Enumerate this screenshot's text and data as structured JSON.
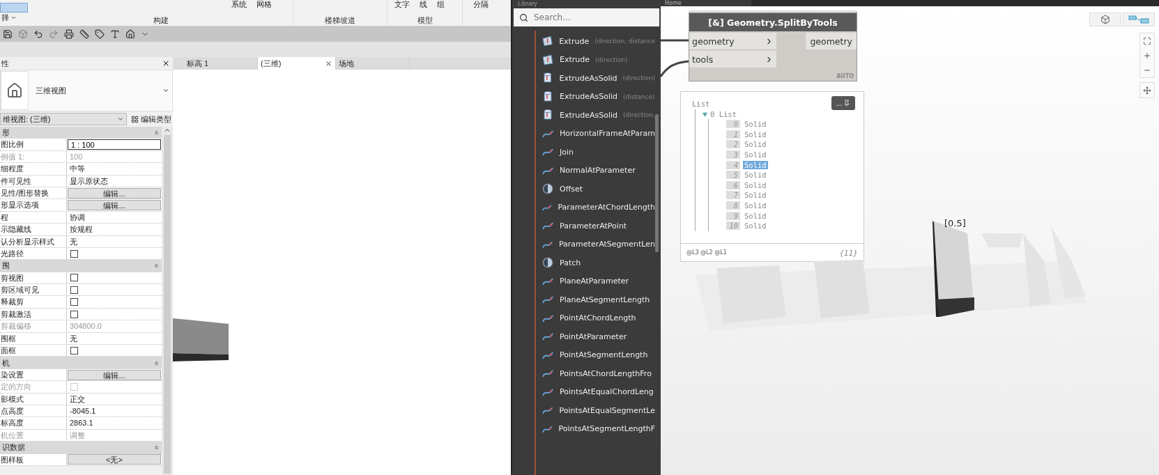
{
  "ribbon": {
    "select_label": "择",
    "panels": [
      {
        "label": "构建",
        "buttons": [
          "系统",
          "网格"
        ]
      },
      {
        "label": "楼梯坡道"
      },
      {
        "label": "模型",
        "buttons": [
          "文字",
          "线",
          "组"
        ]
      },
      {
        "buttons": [
          "分隔"
        ]
      }
    ]
  },
  "view_tabs": [
    {
      "label": "标高 1",
      "selected": false
    },
    {
      "label": "(三维)",
      "selected": true
    },
    {
      "label": "场地",
      "selected": false
    }
  ],
  "properties": {
    "title": "性",
    "type_name": "三维视图",
    "instance": "维视图: (三维)",
    "edit_type": "编辑类型",
    "sections": [
      {
        "title": "形",
        "rows": [
          {
            "label": "图比例",
            "kind": "input",
            "value": "1 : 100"
          },
          {
            "label": "例值 1:",
            "kind": "text",
            "value": "100",
            "disabled": true
          },
          {
            "label": "细程度",
            "kind": "text",
            "value": "中等"
          },
          {
            "label": "件可见性",
            "kind": "text",
            "value": "显示原状态"
          },
          {
            "label": "见性/图形替换",
            "kind": "button",
            "value": "编辑..."
          },
          {
            "label": "形显示选项",
            "kind": "button",
            "value": "编辑..."
          },
          {
            "label": "程",
            "kind": "text",
            "value": "协调"
          },
          {
            "label": "示隐藏线",
            "kind": "text",
            "value": "按规程"
          },
          {
            "label": "认分析显示样式",
            "kind": "text",
            "value": "无"
          },
          {
            "label": "光路径",
            "kind": "checkbox",
            "checked": false
          }
        ]
      },
      {
        "title": "围",
        "rows": [
          {
            "label": "剪视图",
            "kind": "checkbox",
            "checked": false
          },
          {
            "label": "剪区域可见",
            "kind": "checkbox",
            "checked": false
          },
          {
            "label": "释裁剪",
            "kind": "checkbox",
            "checked": false
          },
          {
            "label": "剪裁激活",
            "kind": "checkbox",
            "checked": false
          },
          {
            "label": "剪裁偏移",
            "kind": "text",
            "value": "304800.0",
            "disabled": true
          },
          {
            "label": "围框",
            "kind": "text",
            "value": "无"
          },
          {
            "label": "面框",
            "kind": "checkbox",
            "checked": false
          }
        ]
      },
      {
        "title": "机",
        "rows": [
          {
            "label": "染设置",
            "kind": "button",
            "value": "编辑..."
          },
          {
            "label": "定的方向",
            "kind": "checkbox",
            "checked": false,
            "disabled": true
          },
          {
            "label": "影模式",
            "kind": "text",
            "value": "正交"
          },
          {
            "label": "点高度",
            "kind": "text",
            "value": "-8045.1"
          },
          {
            "label": "标高度",
            "kind": "text",
            "value": "2863.1"
          },
          {
            "label": "机位置",
            "kind": "text",
            "value": "调整",
            "disabled": true
          }
        ]
      },
      {
        "title": "识数据",
        "rows": [
          {
            "label": "图样板",
            "kind": "button",
            "value": "<无>"
          }
        ]
      }
    ]
  },
  "library": {
    "title": "Library",
    "search": {
      "placeholder": "Search..."
    },
    "items": [
      {
        "name": "Extrude",
        "hint": "(direction, distance",
        "kind": "surface"
      },
      {
        "name": "Extrude",
        "hint": "(direction)",
        "kind": "surface"
      },
      {
        "name": "ExtrudeAsSolid",
        "hint": "(direction)",
        "kind": "solid"
      },
      {
        "name": "ExtrudeAsSolid",
        "hint": "(distance)",
        "kind": "solid"
      },
      {
        "name": "ExtrudeAsSolid",
        "hint": "(direction,",
        "kind": "solid"
      },
      {
        "name": "HorizontalFrameAtParam",
        "kind": "curve"
      },
      {
        "name": "Join",
        "kind": "curve"
      },
      {
        "name": "NormalAtParameter",
        "kind": "curve"
      },
      {
        "name": "Offset",
        "kind": "disc"
      },
      {
        "name": "ParameterAtChordLength",
        "kind": "curve"
      },
      {
        "name": "ParameterAtPoint",
        "kind": "curve"
      },
      {
        "name": "ParameterAtSegmentLen",
        "kind": "curve"
      },
      {
        "name": "Patch",
        "kind": "disc"
      },
      {
        "name": "PlaneAtParameter",
        "kind": "curve"
      },
      {
        "name": "PlaneAtSegmentLength",
        "kind": "curve"
      },
      {
        "name": "PointAtChordLength",
        "kind": "curve"
      },
      {
        "name": "PointAtParameter",
        "kind": "curve"
      },
      {
        "name": "PointAtSegmentLength",
        "kind": "curve"
      },
      {
        "name": "PointsAtChordLengthFro",
        "kind": "curve"
      },
      {
        "name": "PointsAtEqualChordLeng",
        "kind": "curve"
      },
      {
        "name": "PointsAtEqualSegmentLe",
        "kind": "curve"
      },
      {
        "name": "PointsAtSegmentLengthF",
        "kind": "curve"
      }
    ]
  },
  "canvas": {
    "tab": "Home",
    "node": {
      "title": "[&] Geometry.SplitByTools",
      "inputs": [
        "geometry",
        "tools"
      ],
      "outputs": [
        "geometry"
      ],
      "lacing": "AUTO"
    },
    "preview": {
      "root": "List",
      "branch_index": "0",
      "branch": "List",
      "items": [
        {
          "index": "0",
          "value": "Solid",
          "selected": false
        },
        {
          "index": "1",
          "value": "Solid",
          "selected": false
        },
        {
          "index": "2",
          "value": "Solid",
          "selected": false
        },
        {
          "index": "3",
          "value": "Solid",
          "selected": false
        },
        {
          "index": "4",
          "value": "Solid",
          "selected": true
        },
        {
          "index": "5",
          "value": "Solid",
          "selected": false
        },
        {
          "index": "6",
          "value": "Solid",
          "selected": false
        },
        {
          "index": "7",
          "value": "Solid",
          "selected": false
        },
        {
          "index": "8",
          "value": "Solid",
          "selected": false
        },
        {
          "index": "9",
          "value": "Solid",
          "selected": false
        },
        {
          "index": "10",
          "value": "Solid",
          "selected": false
        }
      ],
      "levels": "@L3 @L2 @L1",
      "count": "{11}",
      "menu": "..."
    },
    "geometry_label": "[0.5]"
  }
}
